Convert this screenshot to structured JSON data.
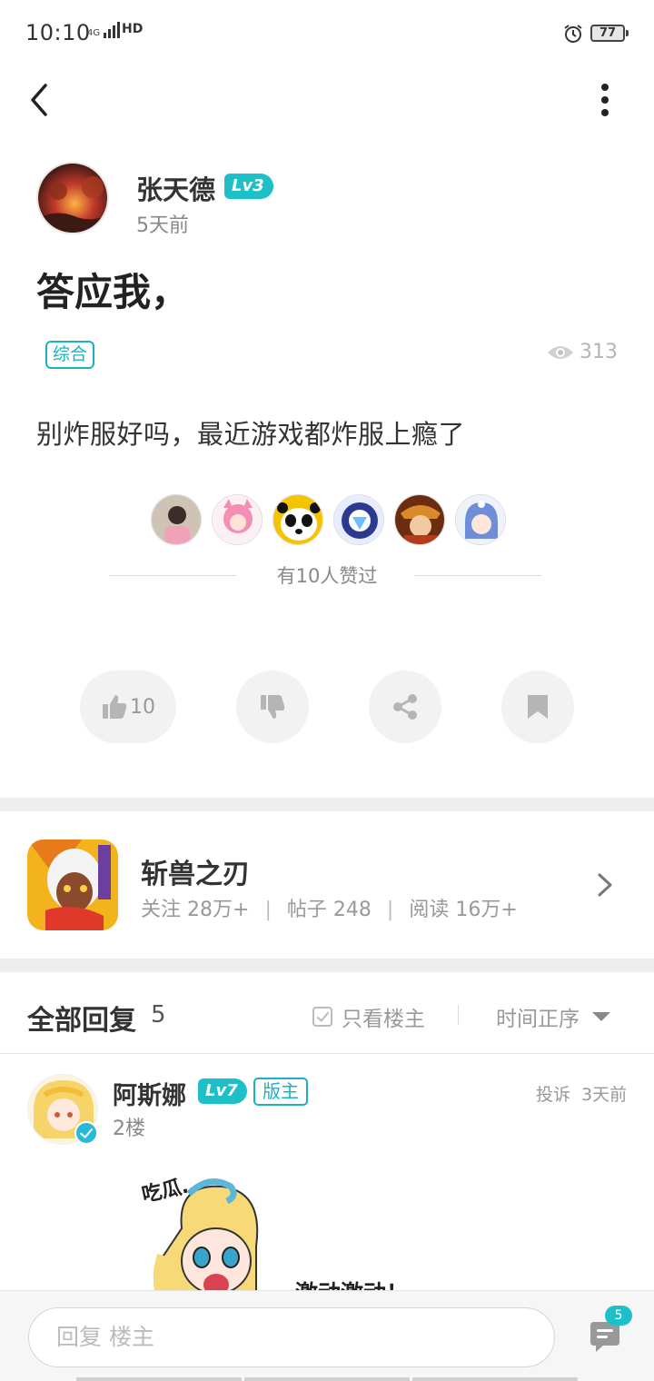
{
  "status_bar": {
    "time": "10:10",
    "network": "4G",
    "hd": "HD",
    "battery": "77"
  },
  "post": {
    "author_name": "张天德",
    "author_level": "Lv3",
    "posted_time": "5天前",
    "title": "答应我，",
    "tag": "综合",
    "views": "313",
    "body": "别炸服好吗，最近游戏都炸服上瘾了",
    "likers_text": "有10人赞过",
    "like_count": "10"
  },
  "game_card": {
    "name": "斩兽之刃",
    "followers_label": "关注",
    "followers": "28万+",
    "posts_label": "帖子",
    "posts": "248",
    "reads_label": "阅读",
    "reads": "16万+"
  },
  "replies": {
    "title": "全部回复",
    "count": "5",
    "only_owner": "只看楼主",
    "sort": "时间正序"
  },
  "first_reply": {
    "name": "阿斯娜",
    "level": "Lv7",
    "role": "版主",
    "floor": "2楼",
    "report": "投诉",
    "time": "3天前",
    "text": "激动激动！",
    "sticker_text": "吃瓜…"
  },
  "bottom_bar": {
    "placeholder": "回复  楼主",
    "comment_count": "5"
  },
  "colors": {
    "accent": "#1ec0c8",
    "tag_border": "#17b3c3",
    "separator": "#eeeeee"
  }
}
